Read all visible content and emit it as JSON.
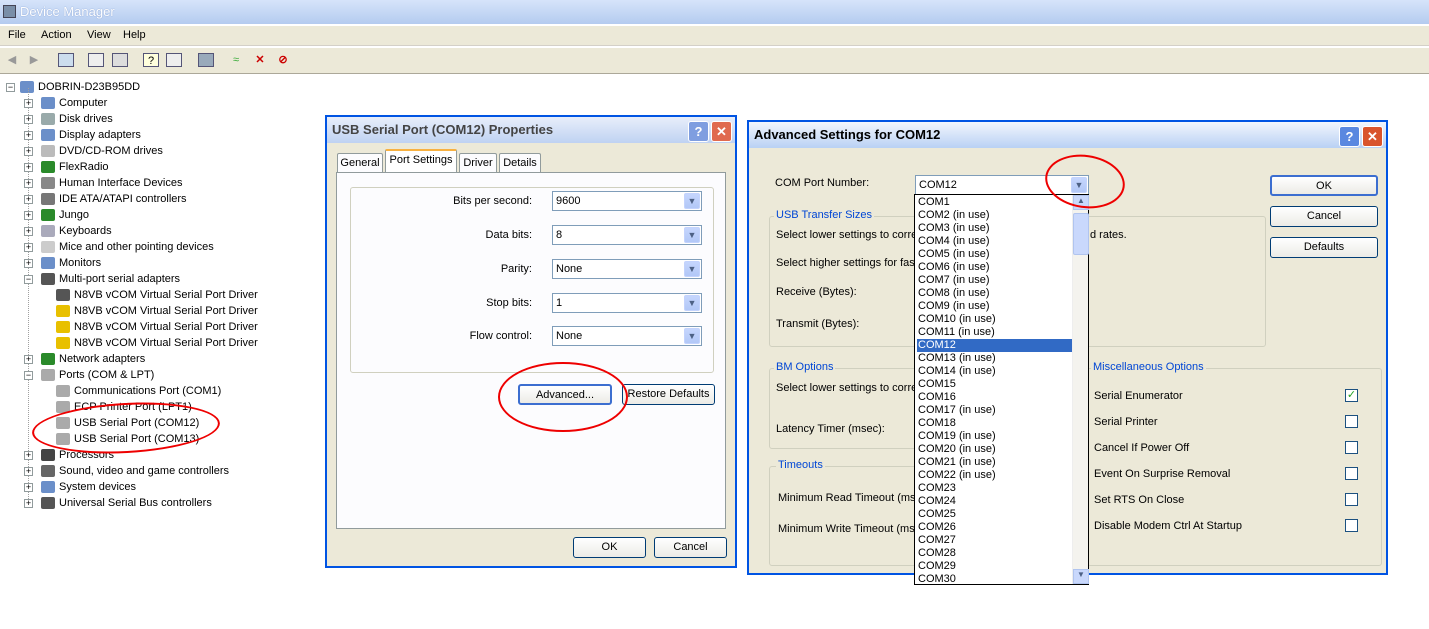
{
  "window": {
    "title": "Device Manager"
  },
  "menu": [
    "File",
    "Action",
    "View",
    "Help"
  ],
  "tree": {
    "root": "DOBRIN-D23B95DD",
    "items": [
      {
        "label": "Computer",
        "icon": "computer-icon"
      },
      {
        "label": "Disk drives",
        "icon": "disk-icon"
      },
      {
        "label": "Display adapters",
        "icon": "display-icon"
      },
      {
        "label": "DVD/CD-ROM drives",
        "icon": "cdrom-icon"
      },
      {
        "label": "FlexRadio",
        "icon": "chip-icon"
      },
      {
        "label": "Human Interface Devices",
        "icon": "hid-icon"
      },
      {
        "label": "IDE ATA/ATAPI controllers",
        "icon": "ide-icon"
      },
      {
        "label": "Jungo",
        "icon": "chip-icon"
      },
      {
        "label": "Keyboards",
        "icon": "keyboard-icon"
      },
      {
        "label": "Mice and other pointing devices",
        "icon": "mouse-icon"
      },
      {
        "label": "Monitors",
        "icon": "monitor-icon"
      },
      {
        "label": "Multi-port serial adapters",
        "icon": "serial-icon"
      },
      {
        "label": "N8VB vCOM Virtual Serial Port Driver",
        "icon": "serial-icon",
        "child": true
      },
      {
        "label": "N8VB vCOM Virtual Serial Port Driver",
        "icon": "warning-icon",
        "child": true
      },
      {
        "label": "N8VB vCOM Virtual Serial Port Driver",
        "icon": "warning-icon",
        "child": true
      },
      {
        "label": "N8VB vCOM Virtual Serial Port Driver",
        "icon": "warning-icon",
        "child": true
      },
      {
        "label": "Network adapters",
        "icon": "network-icon"
      },
      {
        "label": "Ports (COM & LPT)",
        "icon": "port-icon"
      },
      {
        "label": "Communications Port (COM1)",
        "icon": "port-icon",
        "child": true
      },
      {
        "label": "ECP Printer Port (LPT1)",
        "icon": "port-icon",
        "child": true
      },
      {
        "label": "USB Serial Port (COM12)",
        "icon": "port-icon",
        "child": true
      },
      {
        "label": "USB Serial Port (COM13)",
        "icon": "port-icon",
        "child": true
      },
      {
        "label": "Processors",
        "icon": "cpu-icon"
      },
      {
        "label": "Sound, video and game controllers",
        "icon": "sound-icon"
      },
      {
        "label": "System devices",
        "icon": "system-icon"
      },
      {
        "label": "Universal Serial Bus controllers",
        "icon": "usb-icon"
      }
    ]
  },
  "props": {
    "title": "USB Serial Port (COM12) Properties",
    "tabs": [
      "General",
      "Port Settings",
      "Driver",
      "Details"
    ],
    "fields": [
      {
        "label": "Bits per second:",
        "value": "9600"
      },
      {
        "label": "Data bits:",
        "value": "8"
      },
      {
        "label": "Parity:",
        "value": "None"
      },
      {
        "label": "Stop bits:",
        "value": "1"
      },
      {
        "label": "Flow control:",
        "value": "None"
      }
    ],
    "advanced": "Advanced...",
    "restore": "Restore Defaults",
    "ok": "OK",
    "cancel": "Cancel",
    "help": "?",
    "close": "✕"
  },
  "adv": {
    "title": "Advanced Settings for COM12",
    "com_label": "COM Port Number:",
    "com_value": "COM12",
    "usb_group": "USB Transfer Sizes",
    "usb_text1": "Select lower settings to corre",
    "usb_text1b": "d rates.",
    "usb_text2": "Select higher settings for fas",
    "receive": "Receive (Bytes):",
    "transmit": "Transmit (Bytes):",
    "bm_group": "BM Options",
    "bm_text": "Select lower settings to corre",
    "latency": "Latency Timer (msec):",
    "timeouts_group": "Timeouts",
    "min_read": "Minimum Read Timeout (msec",
    "min_write": "Minimum Write Timeout (msec",
    "misc_group": "Miscellaneous Options",
    "misc": [
      {
        "label": "Serial Enumerator",
        "checked": true
      },
      {
        "label": "Serial Printer",
        "checked": false
      },
      {
        "label": "Cancel If Power Off",
        "checked": false
      },
      {
        "label": "Event On Surprise Removal",
        "checked": false
      },
      {
        "label": "Set RTS On Close",
        "checked": false
      },
      {
        "label": "Disable Modem Ctrl At Startup",
        "checked": false
      }
    ],
    "ok": "OK",
    "cancel": "Cancel",
    "defaults": "Defaults",
    "help": "?",
    "close": "✕",
    "com_list": [
      "COM1",
      "COM2 (in use)",
      "COM3 (in use)",
      "COM4 (in use)",
      "COM5 (in use)",
      "COM6 (in use)",
      "COM7 (in use)",
      "COM8 (in use)",
      "COM9 (in use)",
      "COM10 (in use)",
      "COM11 (in use)",
      "COM12",
      "COM13 (in use)",
      "COM14 (in use)",
      "COM15",
      "COM16",
      "COM17 (in use)",
      "COM18",
      "COM19 (in use)",
      "COM20 (in use)",
      "COM21 (in use)",
      "COM22 (in use)",
      "COM23",
      "COM24",
      "COM25",
      "COM26",
      "COM27",
      "COM28",
      "COM29",
      "COM30"
    ],
    "selected_index": 11
  },
  "colors": {
    "annotation": "#ee0000",
    "selection": "#316ac5",
    "title_blue": "#0054e3"
  }
}
